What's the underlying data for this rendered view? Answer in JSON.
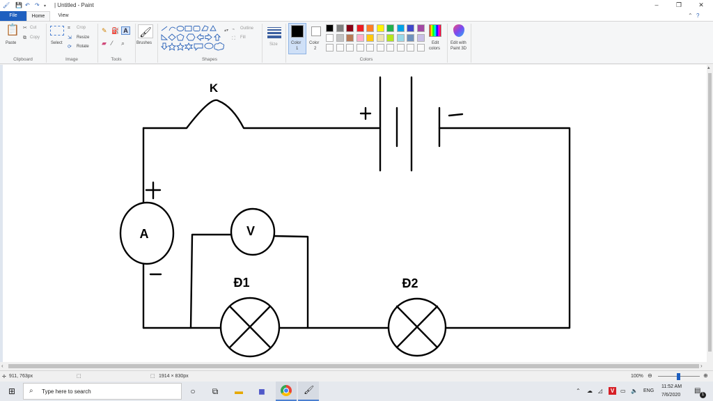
{
  "window": {
    "title": "| Untitled - Paint",
    "controls": {
      "minimize": "–",
      "maximize": "❐",
      "close": "✕"
    }
  },
  "tabs": {
    "file": "File",
    "home": "Home",
    "view": "View"
  },
  "ribbon": {
    "clipboard": {
      "label": "Clipboard",
      "paste": "Paste",
      "cut": "Cut",
      "copy": "Copy"
    },
    "image": {
      "label": "Image",
      "select": "Select",
      "crop": "Crop",
      "resize": "Resize",
      "rotate": "Rotate"
    },
    "tools": {
      "label": "Tools"
    },
    "brushes": {
      "label": "Brushes"
    },
    "shapes": {
      "label": "Shapes",
      "outline": "Outline",
      "fill": "Fill"
    },
    "size": {
      "label": "Size"
    },
    "color1": {
      "line1": "Color",
      "line2": "1"
    },
    "color2": {
      "line1": "Color",
      "line2": "2"
    },
    "colors": {
      "label": "Colors",
      "edit_line1": "Edit",
      "edit_line2": "colors",
      "swatches_row1": [
        "#000000",
        "#7f7f7f",
        "#880015",
        "#ed1c24",
        "#ff7f27",
        "#fff200",
        "#22b14c",
        "#00a2e8",
        "#3f48cc",
        "#a349a4"
      ],
      "swatches_row2": [
        "#ffffff",
        "#c3c3c3",
        "#b97a57",
        "#ffaec9",
        "#ffc90e",
        "#efe4b0",
        "#b5e61d",
        "#99d9ea",
        "#7092be",
        "#c8bfe7"
      ]
    },
    "paint3d": {
      "line1": "Edit with",
      "line2": "Paint 3D"
    }
  },
  "drawing": {
    "switch_label": "K",
    "ammeter_label": "A",
    "voltmeter_label": "V",
    "lamp1_label": "Đ1",
    "lamp2_label": "Đ2",
    "plus": "+",
    "minus": "–"
  },
  "status": {
    "cursor_pos": "911, 763px",
    "image_size": "1914 × 830px",
    "zoom": "100%"
  },
  "taskbar": {
    "search_placeholder": "Type here to search",
    "language": "ENG",
    "time": "11:52 AM",
    "date": "7/6/2020",
    "notification_count": "1"
  }
}
